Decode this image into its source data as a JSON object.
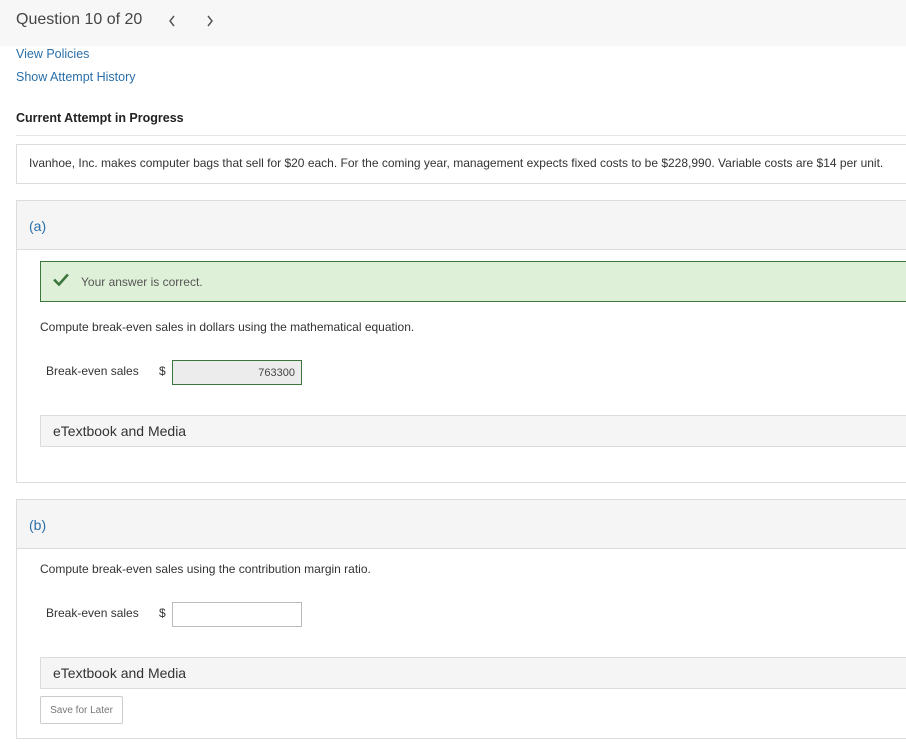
{
  "header": {
    "question_counter": "Question 10 of 20",
    "prev_glyph": "‹",
    "next_glyph": "›"
  },
  "links": {
    "view_policies": "View Policies",
    "show_attempt_history": "Show Attempt History"
  },
  "attempt": {
    "label": "Current Attempt in Progress"
  },
  "question": {
    "text": "Ivanhoe, Inc. makes computer bags that sell for $20 each. For the coming year, management expects fixed costs to be $228,990. Variable costs are $14 per unit."
  },
  "part_a": {
    "label": "(a)",
    "feedback": "Your answer is correct.",
    "instruction": "Compute break-even sales in dollars using the mathematical equation.",
    "row_label": "Break-even sales",
    "currency": "$",
    "answer_value": "763300",
    "etextbook": "eTextbook and Media"
  },
  "part_b": {
    "label": "(b)",
    "instruction": "Compute break-even sales using the contribution margin ratio.",
    "row_label": "Break-even sales",
    "currency": "$",
    "answer_value": "",
    "etextbook": "eTextbook and Media",
    "save_button": "Save for Later"
  },
  "colors": {
    "link": "#2a6fa8",
    "success_bg": "#dff0d8",
    "success_border": "#3c763d",
    "check": "#3c763d"
  },
  "icons": {
    "prev": "chevron-left-icon",
    "next": "chevron-right-icon",
    "correct": "check-icon"
  }
}
